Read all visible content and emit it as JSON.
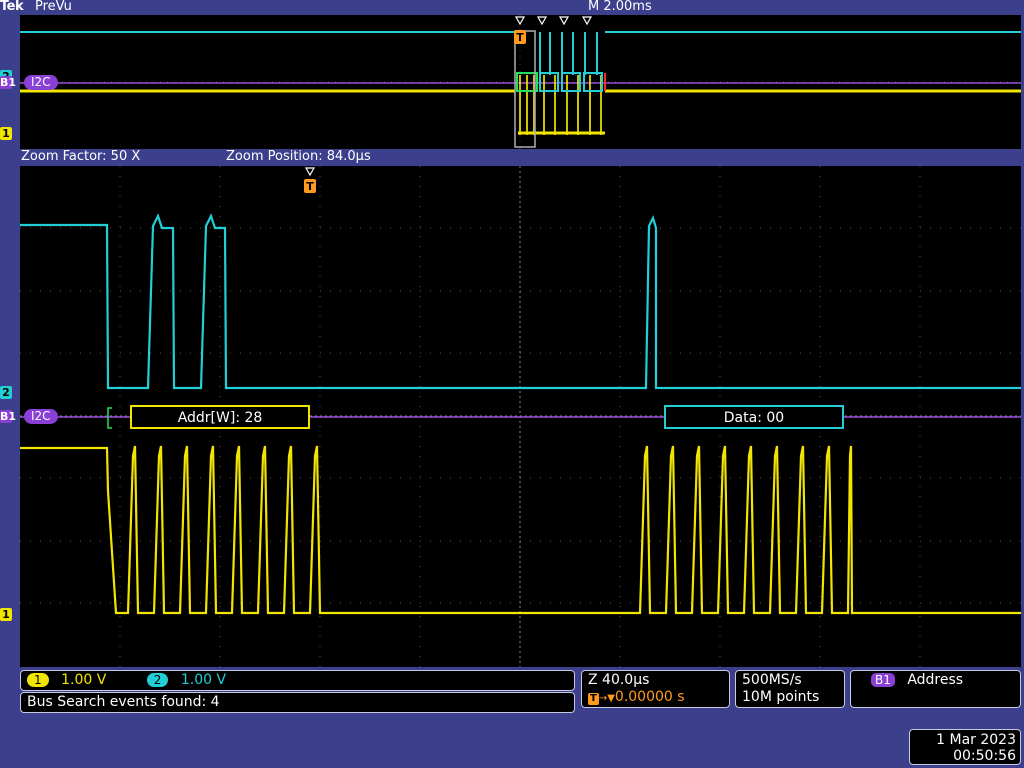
{
  "header": {
    "brand": "Tek",
    "mode": "PreVu",
    "timebase": "M 2.00ms"
  },
  "overview": {
    "bus_label": "I2C",
    "bus_marker": "B1",
    "ch1_marker": "1",
    "ch2_marker": "2",
    "trigger_marker": "T"
  },
  "zoom": {
    "factor_label": "Zoom Factor: 50 X",
    "position_label": "Zoom Position: 84.0µs"
  },
  "main": {
    "bus_label": "I2C",
    "bus_marker": "B1",
    "ch1_marker": "1",
    "ch2_marker": "2",
    "trigger_marker": "T",
    "packets": [
      {
        "text": "Addr[W]: 28",
        "color": "#f2e600"
      },
      {
        "text": "Data: 00",
        "color": "#22cfd6"
      }
    ]
  },
  "status": {
    "ch1": {
      "tag": "1",
      "scale": "1.00 V",
      "color": "#f2e600"
    },
    "ch2": {
      "tag": "2",
      "scale": "1.00 V",
      "color": "#22cfd6"
    },
    "search": "Bus Search events found: 4",
    "zoom_scale": "Z 40.0µs",
    "trigger_pos": "0.00000 s",
    "sample_rate": "500MS/s",
    "record_length": "10M points",
    "trigger_source_tag": "B1",
    "trigger_type": "Address",
    "date": "1 Mar 2023",
    "time": "00:50:56"
  },
  "colors": {
    "ch1": "#f2e600",
    "ch2": "#22cfd6",
    "bus": "#9b4de0",
    "trigger": "#ff9a1f",
    "background": "#3b3f8c",
    "screen": "#000000"
  }
}
